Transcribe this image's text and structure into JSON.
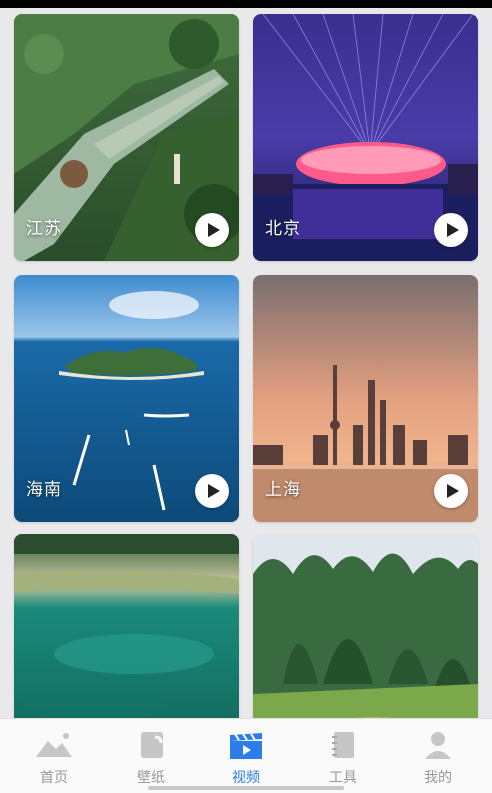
{
  "videos": [
    {
      "label": "江苏",
      "icon": "play-icon"
    },
    {
      "label": "北京",
      "icon": "play-icon"
    },
    {
      "label": "海南",
      "icon": "play-icon"
    },
    {
      "label": "上海",
      "icon": "play-icon"
    },
    {
      "label": "",
      "icon": ""
    },
    {
      "label": "",
      "icon": ""
    }
  ],
  "tabbar": {
    "items": [
      {
        "label": "首页",
        "icon": "mountain-icon"
      },
      {
        "label": "壁纸",
        "icon": "wallpaper-icon"
      },
      {
        "label": "视频",
        "icon": "video-clapper-icon"
      },
      {
        "label": "工具",
        "icon": "notebook-icon"
      },
      {
        "label": "我的",
        "icon": "user-icon"
      }
    ],
    "active_index": 2,
    "active_color": "#2b7de9",
    "inactive_color": "#999999"
  }
}
